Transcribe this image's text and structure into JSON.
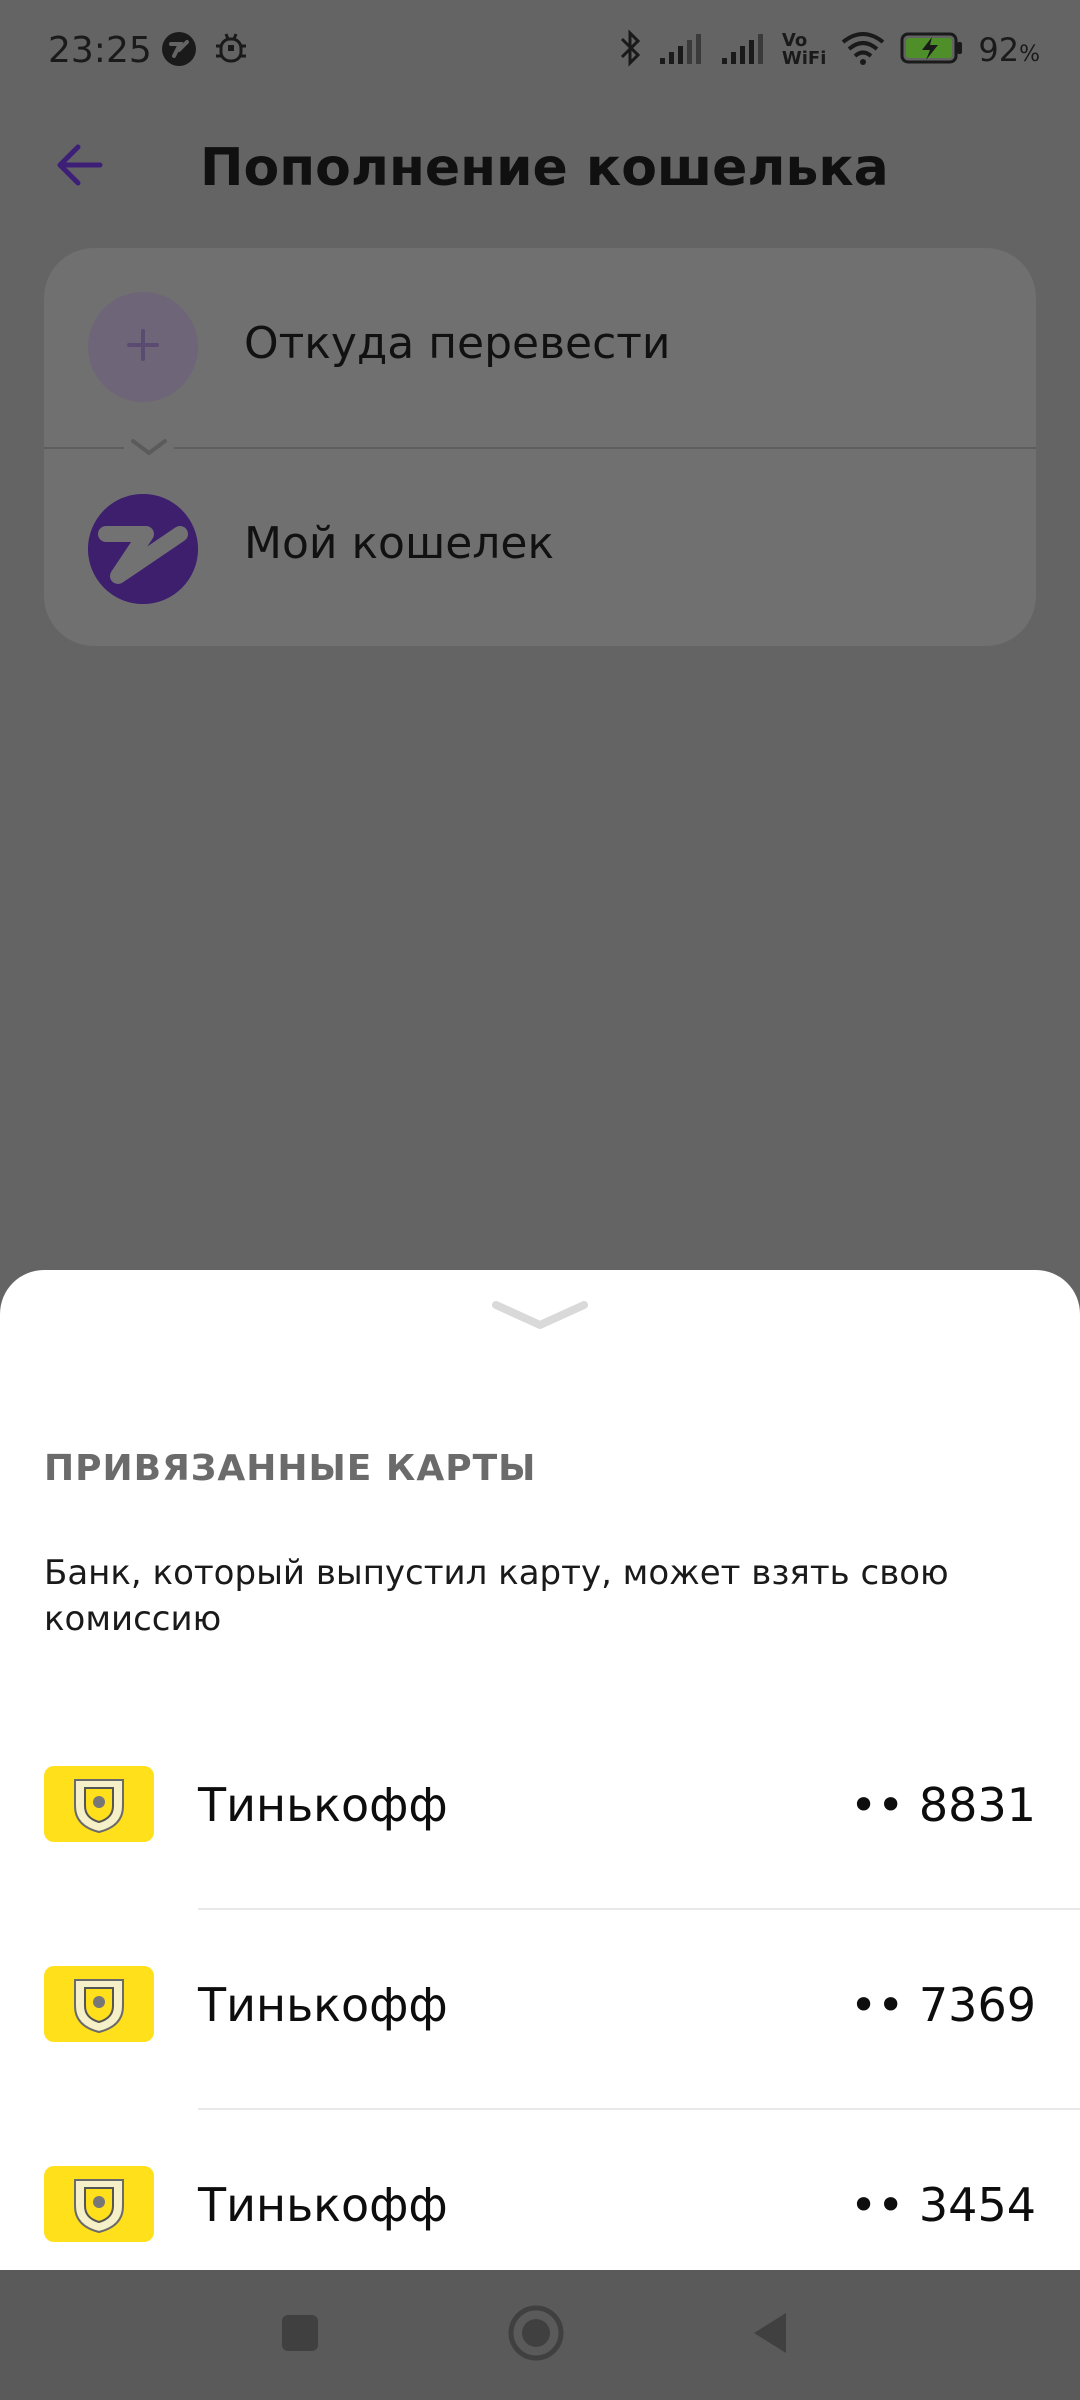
{
  "status_bar": {
    "time": "23:25",
    "battery_percent": "92",
    "battery_percent_sign": "%",
    "icons": [
      "app-notification-icon",
      "bug-icon",
      "bluetooth-icon",
      "signal-icon",
      "signal-icon",
      "vowifi-icon",
      "wifi-icon",
      "battery-charging-icon"
    ],
    "vowifi_label_top": "Vo",
    "vowifi_label_bottom": "WiFi"
  },
  "header": {
    "title": "Пополнение кошелька",
    "back_icon": "arrow-left-icon"
  },
  "transfer": {
    "from_label": "Откуда перевести",
    "to_label": "Мой кошелек"
  },
  "sheet": {
    "heading": "ПРИВЯЗАННЫЕ КАРТЫ",
    "note": "Банк, который выпустил карту, может взять свою комиссию",
    "cards": [
      {
        "bank": "Тинькофф",
        "number": "•• 8831"
      },
      {
        "bank": "Тинькофф",
        "number": "•• 7369"
      },
      {
        "bank": "Тинькофф",
        "number": "•• 3454"
      }
    ]
  },
  "colors": {
    "accent": "#5b2ea6",
    "card_logo": "#ffe01b",
    "dim_overlay": "#646464"
  }
}
